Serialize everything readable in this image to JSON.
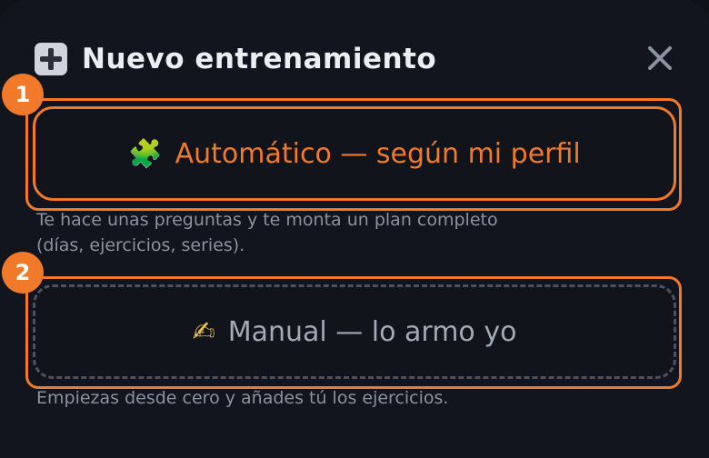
{
  "modal": {
    "title": "Nuevo entrenamiento",
    "header_icon": "plus-icon",
    "close_icon": "close-icon"
  },
  "options": [
    {
      "badge": "1",
      "icon": "puzzle-icon",
      "icon_glyph": "🧩",
      "label": "Automático — según mi perfil",
      "description_line1": "Te hace unas preguntas y te monta un plan completo",
      "description_line2": "(días, ejercicios, series).",
      "accent": "#f07a2a"
    },
    {
      "badge": "2",
      "icon": "writing-hand-icon",
      "icon_glyph": "✍",
      "label": "Manual — lo armo yo",
      "description_line1": "Empiezas desde cero y añades tú los ejercicios.",
      "accent": "#a3a9b5"
    }
  ],
  "colors": {
    "background": "#12151d",
    "highlight": "#f07a2a",
    "text": "#eceef2",
    "muted": "#8b92a0"
  }
}
